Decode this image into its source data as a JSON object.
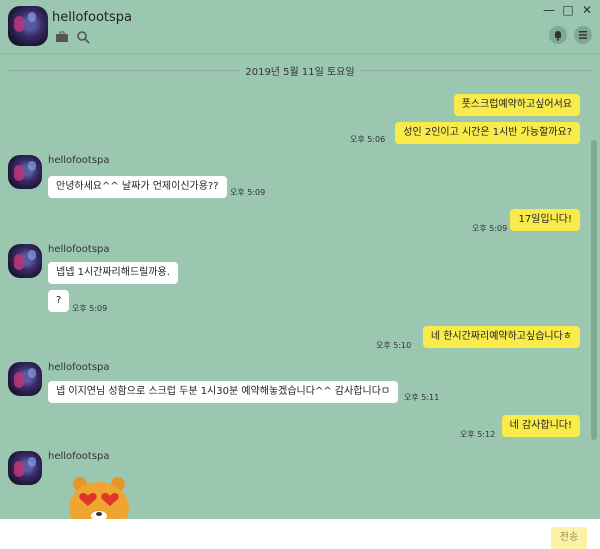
{
  "header": {
    "title": "hellofootspa",
    "window_controls": [
      "—",
      "□",
      "✕"
    ]
  },
  "date_divider": "2019년 5월 11일 토요일",
  "messages": [
    {
      "text": "풋스크럽예약하고싶어서요",
      "time": ""
    },
    {
      "text": "성인 2인이고 시간은 1시반 가능할까요?",
      "time": "오후 5:06"
    },
    {
      "sender": "hellofootspa",
      "text": "안녕하세요^^ 날짜가 언제이신가용??",
      "time": "오후 5:09"
    },
    {
      "text": "17일입니다!",
      "time": "오후 5:09"
    },
    {
      "sender": "hellofootspa",
      "text": "넵넵 1시간짜리해드릴까용.",
      "time": ""
    },
    {
      "text": "?",
      "time": "오후 5:09"
    },
    {
      "text": "네 한시간짜리예약하고싶습니다ㅎ",
      "time": "오후 5:10"
    },
    {
      "sender": "hellofootspa",
      "text": "넵 이지연님 성함으로 스크럽 두분 1시30분 예약해놓겠습니다^^ 감사합니다ㅁ",
      "time": "오후 5:11"
    },
    {
      "text": "네 감사합니다!",
      "time": "오후 5:12"
    },
    {
      "sender": "hellofootspa",
      "text": "",
      "time": ""
    }
  ],
  "input": {
    "send_label": "전송"
  },
  "colors": {
    "background": "#9bc6b0",
    "my_bubble": "#f9eb4b",
    "their_bubble": "#ffffff"
  }
}
